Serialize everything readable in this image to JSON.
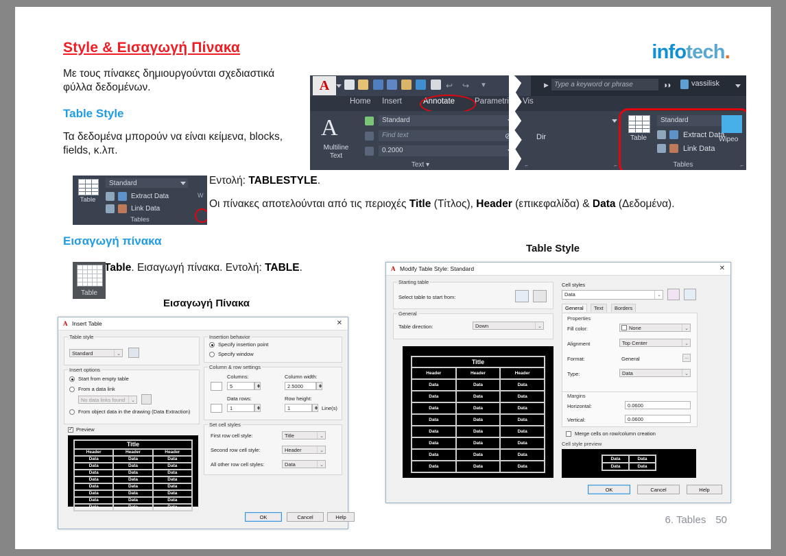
{
  "slide": {
    "title": "Style & Εισαγωγή Πίνακα",
    "intro": "Με τους πίνακες δημιουργούνται σχεδιαστικά φύλλα δεδομένων.",
    "subhead_table_style": "Table Style",
    "body_table_style": "Τα δεδομένα μπορούν να είναι κείμενα, blocks, fields, κ.λπ.",
    "command_line_prefix": "Εντολή: ",
    "command_tablestyle": "TABLESTYLE",
    "command_period": ".",
    "regions_text_1": "Οι πίνακες αποτελούνται από τις περιοχές ",
    "regions_title": "Title",
    "regions_text_2": " (Τίτλος), ",
    "regions_header": "Header",
    "regions_text_3": " (επικεφαλίδα) & ",
    "regions_data": "Data",
    "regions_text_4": " (Δεδομένα).",
    "subhead_insert": "Εισαγωγή πίνακα",
    "table_line_bold": "Table",
    "table_line_mid": ". Εισαγωγή πίνακα. Εντολή: ",
    "table_line_cmd": "TABLE",
    "table_line_end": ".",
    "caption_insert": "Εισαγωγή Πίνακα",
    "caption_style": "Table Style",
    "footer_chapter": "6. Tables",
    "footer_page": "50",
    "logo": {
      "part1": "info",
      "part2": "tech",
      "dot": "."
    }
  },
  "ribbon": {
    "app_menu": "A",
    "search_placeholder": "Type a keyword or phrase",
    "user": "vassilisk",
    "tabs": [
      "Home",
      "Insert",
      "Annotate",
      "Parametric",
      "Vis"
    ],
    "active_tab": "Annotate",
    "text_panel": {
      "big_label": "A",
      "command_label_1": "Multiline",
      "command_label_2": "Text",
      "style_value": "Standard",
      "find_placeholder": "Find text",
      "height_value": "0.2000",
      "panel_name": "Text"
    },
    "dim_panel_label": "Dir",
    "tables_panel": {
      "button_label": "Table",
      "style_value": "Standard",
      "extract_data": "Extract Data",
      "link_data": "Link Data",
      "panel_name": "Tables"
    },
    "wipeout_label": "Wipeo"
  },
  "tables_panel_standalone": {
    "button_label": "Table",
    "style_value": "Standard",
    "extract_data": "Extract Data",
    "link_data": "Link Data",
    "panel_name": "Tables",
    "side_label": "W"
  },
  "table_tool_icon": {
    "label": "Table"
  },
  "insert_table_dialog": {
    "title": "Insert Table",
    "close": "✕",
    "table_style_group": "Table style",
    "table_style_value": "Standard",
    "insert_options_group": "Insert options",
    "opt_empty": "Start from empty table",
    "opt_datalink": "From a data link",
    "datalink_value": "No data links found",
    "opt_object": "From object data in the drawing (Data Extraction)",
    "preview_label": "Preview",
    "insertion_behavior_group": "Insertion behavior",
    "opt_insertion_point": "Specify insertion point",
    "opt_window": "Specify window",
    "colrow_group": "Column & row settings",
    "columns_label": "Columns:",
    "columns_value": "5",
    "column_width_label": "Column width:",
    "column_width_value": "2.5000",
    "data_rows_label": "Data rows:",
    "data_rows_value": "1",
    "row_height_label": "Row height:",
    "row_height_value": "1",
    "row_height_unit": "Line(s)",
    "cell_styles_group": "Set cell styles",
    "first_row_label": "First row cell style:",
    "first_row_value": "Title",
    "second_row_label": "Second row cell style:",
    "second_row_value": "Header",
    "other_rows_label": "All other row cell styles:",
    "other_rows_value": "Data",
    "buttons": {
      "ok": "OK",
      "cancel": "Cancel",
      "help": "Help"
    },
    "preview_table": {
      "title": "Title",
      "headers": [
        "Header",
        "Header",
        "Header"
      ],
      "data_rows": [
        [
          "Data",
          "Data",
          "Data"
        ],
        [
          "Data",
          "Data",
          "Data"
        ],
        [
          "Data",
          "Data",
          "Data"
        ],
        [
          "Data",
          "Data",
          "Data"
        ],
        [
          "Data",
          "Data",
          "Data"
        ],
        [
          "Data",
          "Data",
          "Data"
        ],
        [
          "Data",
          "Data",
          "Data"
        ],
        [
          "Data",
          "Data",
          "Data"
        ]
      ]
    }
  },
  "modify_table_style_dialog": {
    "title": "Modify Table Style: Standard",
    "close": "✕",
    "starting_table_group": "Starting table",
    "select_table_label": "Select table to start from:",
    "general_group": "General",
    "table_direction_label": "Table direction:",
    "table_direction_value": "Down",
    "cell_styles_group": "Cell styles",
    "cell_style_value": "Data",
    "tabs": [
      "General",
      "Text",
      "Borders"
    ],
    "active_tab": "General",
    "properties_group": "Properties",
    "fill_color_label": "Fill color:",
    "fill_color_value": "None",
    "alignment_label": "Alignment",
    "alignment_value": "Top Center",
    "format_label": "Format:",
    "format_value": "General",
    "format_browse": "...",
    "type_label": "Type:",
    "type_value": "Data",
    "margins_group": "Margins",
    "horizontal_label": "Horizontal:",
    "horizontal_value": "0.0600",
    "vertical_label": "Vertical:",
    "vertical_value": "0.0600",
    "merge_cells_label": "Merge cells on row/column creation",
    "cell_style_preview_group": "Cell style preview",
    "buttons": {
      "ok": "OK",
      "cancel": "Cancel",
      "help": "Help"
    },
    "preview_table": {
      "title": "Title",
      "headers": [
        "Header",
        "Header",
        "Header"
      ],
      "data_rows": [
        [
          "Data",
          "Data",
          "Data"
        ],
        [
          "Data",
          "Data",
          "Data"
        ],
        [
          "Data",
          "Data",
          "Data"
        ],
        [
          "Data",
          "Data",
          "Data"
        ],
        [
          "Data",
          "Data",
          "Data"
        ],
        [
          "Data",
          "Data",
          "Data"
        ],
        [
          "Data",
          "Data",
          "Data"
        ],
        [
          "Data",
          "Data",
          "Data"
        ]
      ]
    },
    "cell_preview": [
      [
        "Data",
        "Data"
      ],
      [
        "Data",
        "Data"
      ]
    ]
  },
  "colors": {
    "title_red": "#ef1c24",
    "accent_blue": "#1f9ce4",
    "highlight_red": "#e2050d",
    "ribbon_bg": "#2f3642",
    "slide_bg": "#ffffff",
    "page_bg": "#868686"
  }
}
